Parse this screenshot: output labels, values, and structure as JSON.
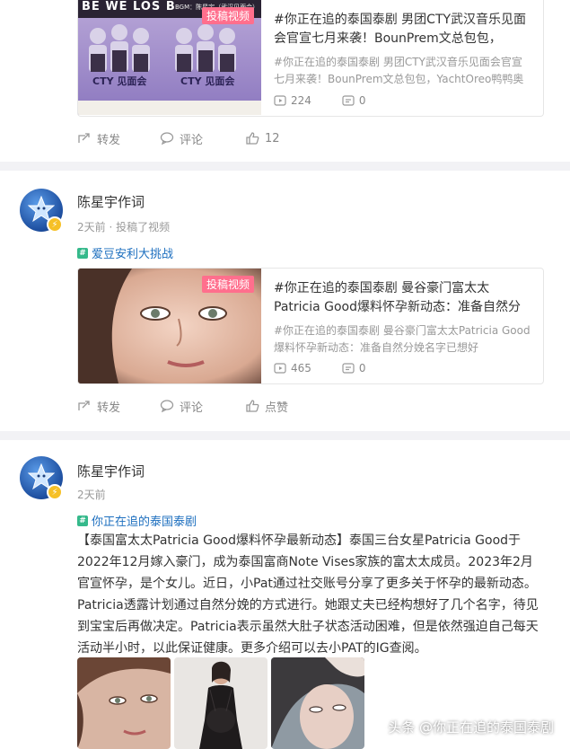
{
  "post1": {
    "video": {
      "tag": "投稿视频",
      "title": "#你正在追的泰国泰剧 男团CTY武汉音乐见面会官宣七月来袭！BounPrem文总包包，Yac…",
      "desc": "#你正在追的泰国泰剧 男团CTY武汉音乐见面会官宣七月来袭！BounPrem文总包包，YachtOreo鸭鸭奥利…",
      "plays": "224",
      "comments": "0",
      "thumb_banner": "BE WE    LOS B",
      "thumb_bgm": "BGM：陈星宇（武汉见面会）",
      "thumb_caption_left": "CTY 见面会",
      "thumb_caption_right": "CTY 见面会"
    },
    "actions": {
      "share": "转发",
      "comment": "评论",
      "like": "12"
    }
  },
  "post2": {
    "author": "陈星宇作词",
    "meta": "2天前 · 投稿了视频",
    "topic": "爱豆安利大挑战",
    "video": {
      "tag": "投稿视频",
      "title": "#你正在追的泰国泰剧 曼谷豪门富太太Patricia Good爆料怀孕新动态：准备自然分娩名字已…",
      "desc": "#你正在追的泰国泰剧 曼谷豪门富太太Patricia Good爆料怀孕新动态：准备自然分娩名字已想好",
      "plays": "465",
      "comments": "0"
    },
    "actions": {
      "share": "转发",
      "comment": "评论",
      "like": "点赞"
    }
  },
  "post3": {
    "author": "陈星宇作词",
    "meta": "2天前",
    "topic": "你正在追的泰国泰剧",
    "text": "【泰国富太太Patricia Good爆料怀孕最新动态】泰国三台女星Patricia Good于2022年12月嫁入豪门，成为泰国富商Note Vises家族的富太太成员。2023年2月官宣怀孕，是个女儿。近日，小Pat通过社交账号分享了更多关于怀孕的最新动态。Patricia透露计划通过自然分娩的方式进行。她跟丈夫已经构想好了几个名字，待见到宝宝后再做决定。Patricia表示虽然大肚子状态活动困难，但是依然强迫自己每天活动半小时，以此保证健康。更多介绍可以去小PAT的IG查阅。"
  },
  "watermark": "头条 @你正在追的泰国泰剧"
}
